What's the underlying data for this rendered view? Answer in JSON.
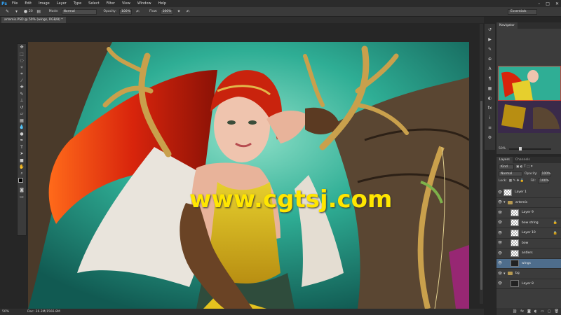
{
  "app": {
    "logo": "Ps"
  },
  "menu": [
    "File",
    "Edit",
    "Image",
    "Layer",
    "Type",
    "Select",
    "Filter",
    "View",
    "Window",
    "Help"
  ],
  "window_controls": {
    "minimize": "–",
    "maximize": "□",
    "close": "✕"
  },
  "options": {
    "brush_size": "20",
    "mode_label": "Mode:",
    "mode_value": "Normal",
    "opacity_label": "Opacity:",
    "opacity_value": "100%",
    "flow_label": "Flow:",
    "flow_value": "100%",
    "workspace": "Essentials"
  },
  "document": {
    "tab_title": "artemis.PSD @ 50% (wings, RGB/8) *"
  },
  "watermark": "www.cgtsj.com",
  "status": {
    "zoom": "50%",
    "doc_info": "Doc: 26.3M/1566.8M"
  },
  "navigator": {
    "tab": "Navigator",
    "zoom": "50%"
  },
  "layers_panel": {
    "tabs": [
      "Layers",
      "Channels"
    ],
    "kind": "Kind",
    "blend_mode": "Normal",
    "opacity_label": "Opacity:",
    "opacity_value": "100%",
    "lock_label": "Lock:",
    "fill_label": "Fill:",
    "fill_value": "100%",
    "layers": [
      {
        "name": "Layer 1",
        "type": "layer",
        "thumb": "check",
        "indent": 0,
        "selected": false,
        "locked": false
      },
      {
        "name": "artemis",
        "type": "group",
        "indent": 0,
        "selected": false,
        "locked": false
      },
      {
        "name": "Layer 9",
        "type": "layer",
        "thumb": "check",
        "indent": 1,
        "selected": false,
        "locked": false
      },
      {
        "name": "bow string",
        "type": "layer",
        "thumb": "check",
        "indent": 1,
        "selected": false,
        "locked": true
      },
      {
        "name": "Layer 10",
        "type": "layer",
        "thumb": "check",
        "indent": 1,
        "selected": false,
        "locked": true
      },
      {
        "name": "bow",
        "type": "layer",
        "thumb": "check",
        "indent": 1,
        "selected": false,
        "locked": false
      },
      {
        "name": "antlers",
        "type": "layer",
        "thumb": "check",
        "indent": 1,
        "selected": false,
        "locked": false
      },
      {
        "name": "wings",
        "type": "layer",
        "thumb": "dark",
        "indent": 1,
        "selected": true,
        "locked": false
      },
      {
        "name": "bg",
        "type": "group",
        "indent": 0,
        "selected": false,
        "locked": false
      },
      {
        "name": "Layer 8",
        "type": "layer",
        "thumb": "dark",
        "indent": 1,
        "selected": false,
        "locked": false
      }
    ]
  },
  "colors": {
    "accent": "#4e6d8c",
    "watermark": "#ffe600",
    "canvas_bg": "#27a58f"
  }
}
